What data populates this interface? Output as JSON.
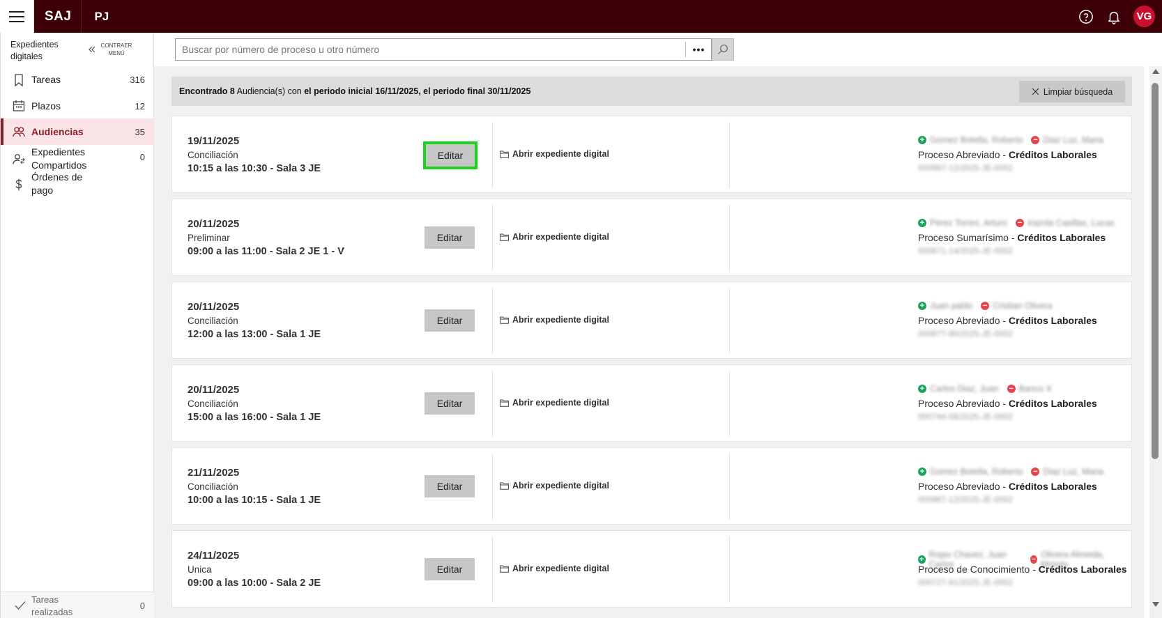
{
  "topbar": {
    "brand": "SAJ",
    "brand2": "PJ",
    "avatar": "VG",
    "icons": [
      "menu-icon",
      "help-icon",
      "bell-icon"
    ]
  },
  "sidebar": {
    "title": "Expedientes digitales",
    "collapse_label": "CONTRAER MENÚ",
    "items": [
      {
        "label": "Tareas",
        "count": "316",
        "icon": "bookmark-icon"
      },
      {
        "label": "Plazos",
        "count": "12",
        "icon": "calendar-icon"
      },
      {
        "label": "Audiencias",
        "count": "35",
        "icon": "people-icon",
        "active": true
      },
      {
        "label": "Expedientes Compartidos",
        "count": "0",
        "icon": "shared-user-icon"
      },
      {
        "label": "Órdenes de pago",
        "count": "",
        "icon": "dollar-icon"
      }
    ],
    "footer": {
      "label": "Tareas realizadas",
      "count": "0",
      "icon": "check-icon"
    }
  },
  "search": {
    "placeholder": "Buscar por número de proceso u otro número",
    "more": "•••"
  },
  "banner": {
    "prefix": "Encontrado 8",
    "middle": " Audiencia(s) con ",
    "suffix": "el periodo inicial 16/11/2025, el periodo final 30/11/2025",
    "clear_label": "Limpiar búsqueda"
  },
  "cards": [
    {
      "date": "19/11/2025",
      "type": "Conciliación",
      "time": "10:15 a las 10:30 - Sala 3 JE",
      "edit": "Editar",
      "open": "Abrir expediente digital",
      "party_a": "Gomez Botella, Roberto",
      "party_b": "Diaz Luz, Maria",
      "proc_a": "Proceso Abreviado",
      "proc_b": "Créditos Laborales",
      "num": "000987-12/2025-JE-0002"
    },
    {
      "date": "20/11/2025",
      "type": "Preliminar",
      "time": "09:00 a las 11:00 - Sala 2 JE 1 - V",
      "edit": "Editar",
      "open": "Abrir expediente digital",
      "party_a": "Pérez Torres, Arturo",
      "party_b": "Irazola Casillas, Lucas",
      "proc_a": "Proceso Sumarísimo",
      "proc_b": "Créditos Laborales",
      "num": "000871-14/2025-JE-0002"
    },
    {
      "date": "20/11/2025",
      "type": "Conciliación",
      "time": "12:00 a las 13:00 - Sala 1 JE",
      "edit": "Editar",
      "open": "Abrir expediente digital",
      "party_a": "Juan pablo",
      "party_b": "Cristian Olivera",
      "proc_a": "Proceso Abreviado",
      "proc_b": "Créditos Laborales",
      "num": "000877-90/2025-JE-0002"
    },
    {
      "date": "20/11/2025",
      "type": "Conciliación",
      "time": "15:00 a las 16:00 - Sala 1 JE",
      "edit": "Editar",
      "open": "Abrir expediente digital",
      "party_a": "Carlos Diaz, Juan",
      "party_b": "Banco X",
      "proc_a": "Proceso Abreviado",
      "proc_b": "Créditos Laborales",
      "num": "000744-06/2025-JE-0002"
    },
    {
      "date": "21/11/2025",
      "type": "Conciliación",
      "time": "10:00 a las 10:15 - Sala 1 JE",
      "edit": "Editar",
      "open": "Abrir expediente digital",
      "party_a": "Gomez Botella, Roberto",
      "party_b": "Diaz Luz, Maria",
      "proc_a": "Proceso Abreviado",
      "proc_b": "Créditos Laborales",
      "num": "000987-12/2025-JE-0002"
    },
    {
      "date": "24/11/2025",
      "type": "Unica",
      "time": "09:00 a las 10:00 - Sala 2 JE",
      "edit": "Editar",
      "open": "Abrir expediente digital",
      "party_a": "Rojas Chavez, Juan Carlos",
      "party_b": "Olivera Almeida, Moisés",
      "proc_a": "Proceso de Conocimiento",
      "proc_b": "Créditos Laborales",
      "num": "000727-91/2025-JE-0002"
    }
  ]
}
